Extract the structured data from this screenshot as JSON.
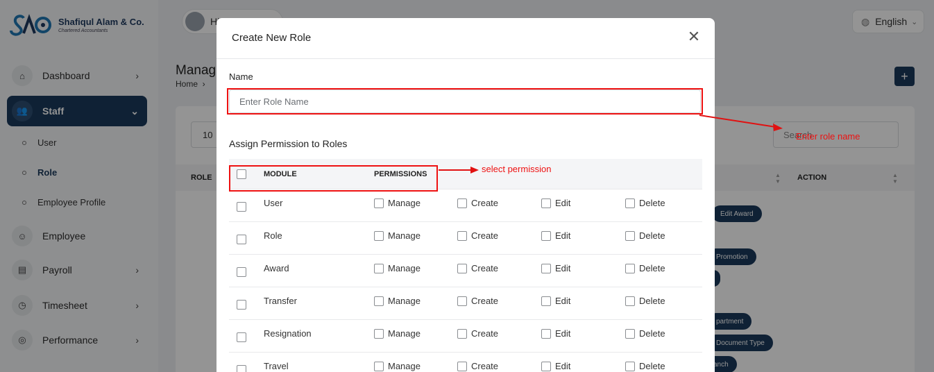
{
  "brand": {
    "name": "Shafiqul Alam & Co.",
    "tagline": "Chartered Accountants"
  },
  "topbar": {
    "greeting": "Hi",
    "language": "English"
  },
  "sidebar": {
    "items": [
      {
        "label": "Dashboard",
        "icon": "home-icon"
      },
      {
        "label": "Staff",
        "icon": "users-icon"
      },
      {
        "label": "Employee",
        "icon": "user-icon"
      },
      {
        "label": "Payroll",
        "icon": "payroll-icon"
      },
      {
        "label": "Timesheet",
        "icon": "clock-icon"
      },
      {
        "label": "Performance",
        "icon": "target-icon"
      }
    ],
    "staff_sub": [
      {
        "label": "User"
      },
      {
        "label": "Role"
      },
      {
        "label": "Employee Profile"
      }
    ]
  },
  "page": {
    "title": "Manag",
    "breadcrumb": "Home",
    "entries_value": "10",
    "search_placeholder": "Search",
    "col_role": "ROLE",
    "col_action": "ACTION",
    "pills": [
      "Edit Award",
      "Promotion",
      "partment",
      "Document Type",
      "anch"
    ]
  },
  "modal": {
    "title": "Create New Role",
    "name_label": "Name",
    "name_placeholder": "Enter Role Name",
    "name_value": "",
    "section_title": "Assign Permission to Roles",
    "header_module": "MODULE",
    "header_permissions": "PERMISSIONS",
    "permission_labels": [
      "Manage",
      "Create",
      "Edit",
      "Delete"
    ],
    "modules": [
      "User",
      "Role",
      "Award",
      "Transfer",
      "Resignation",
      "Travel"
    ]
  },
  "annotations": {
    "name_hint": "Enter role name",
    "permission_hint": "select permission",
    "color": "#e11111"
  }
}
